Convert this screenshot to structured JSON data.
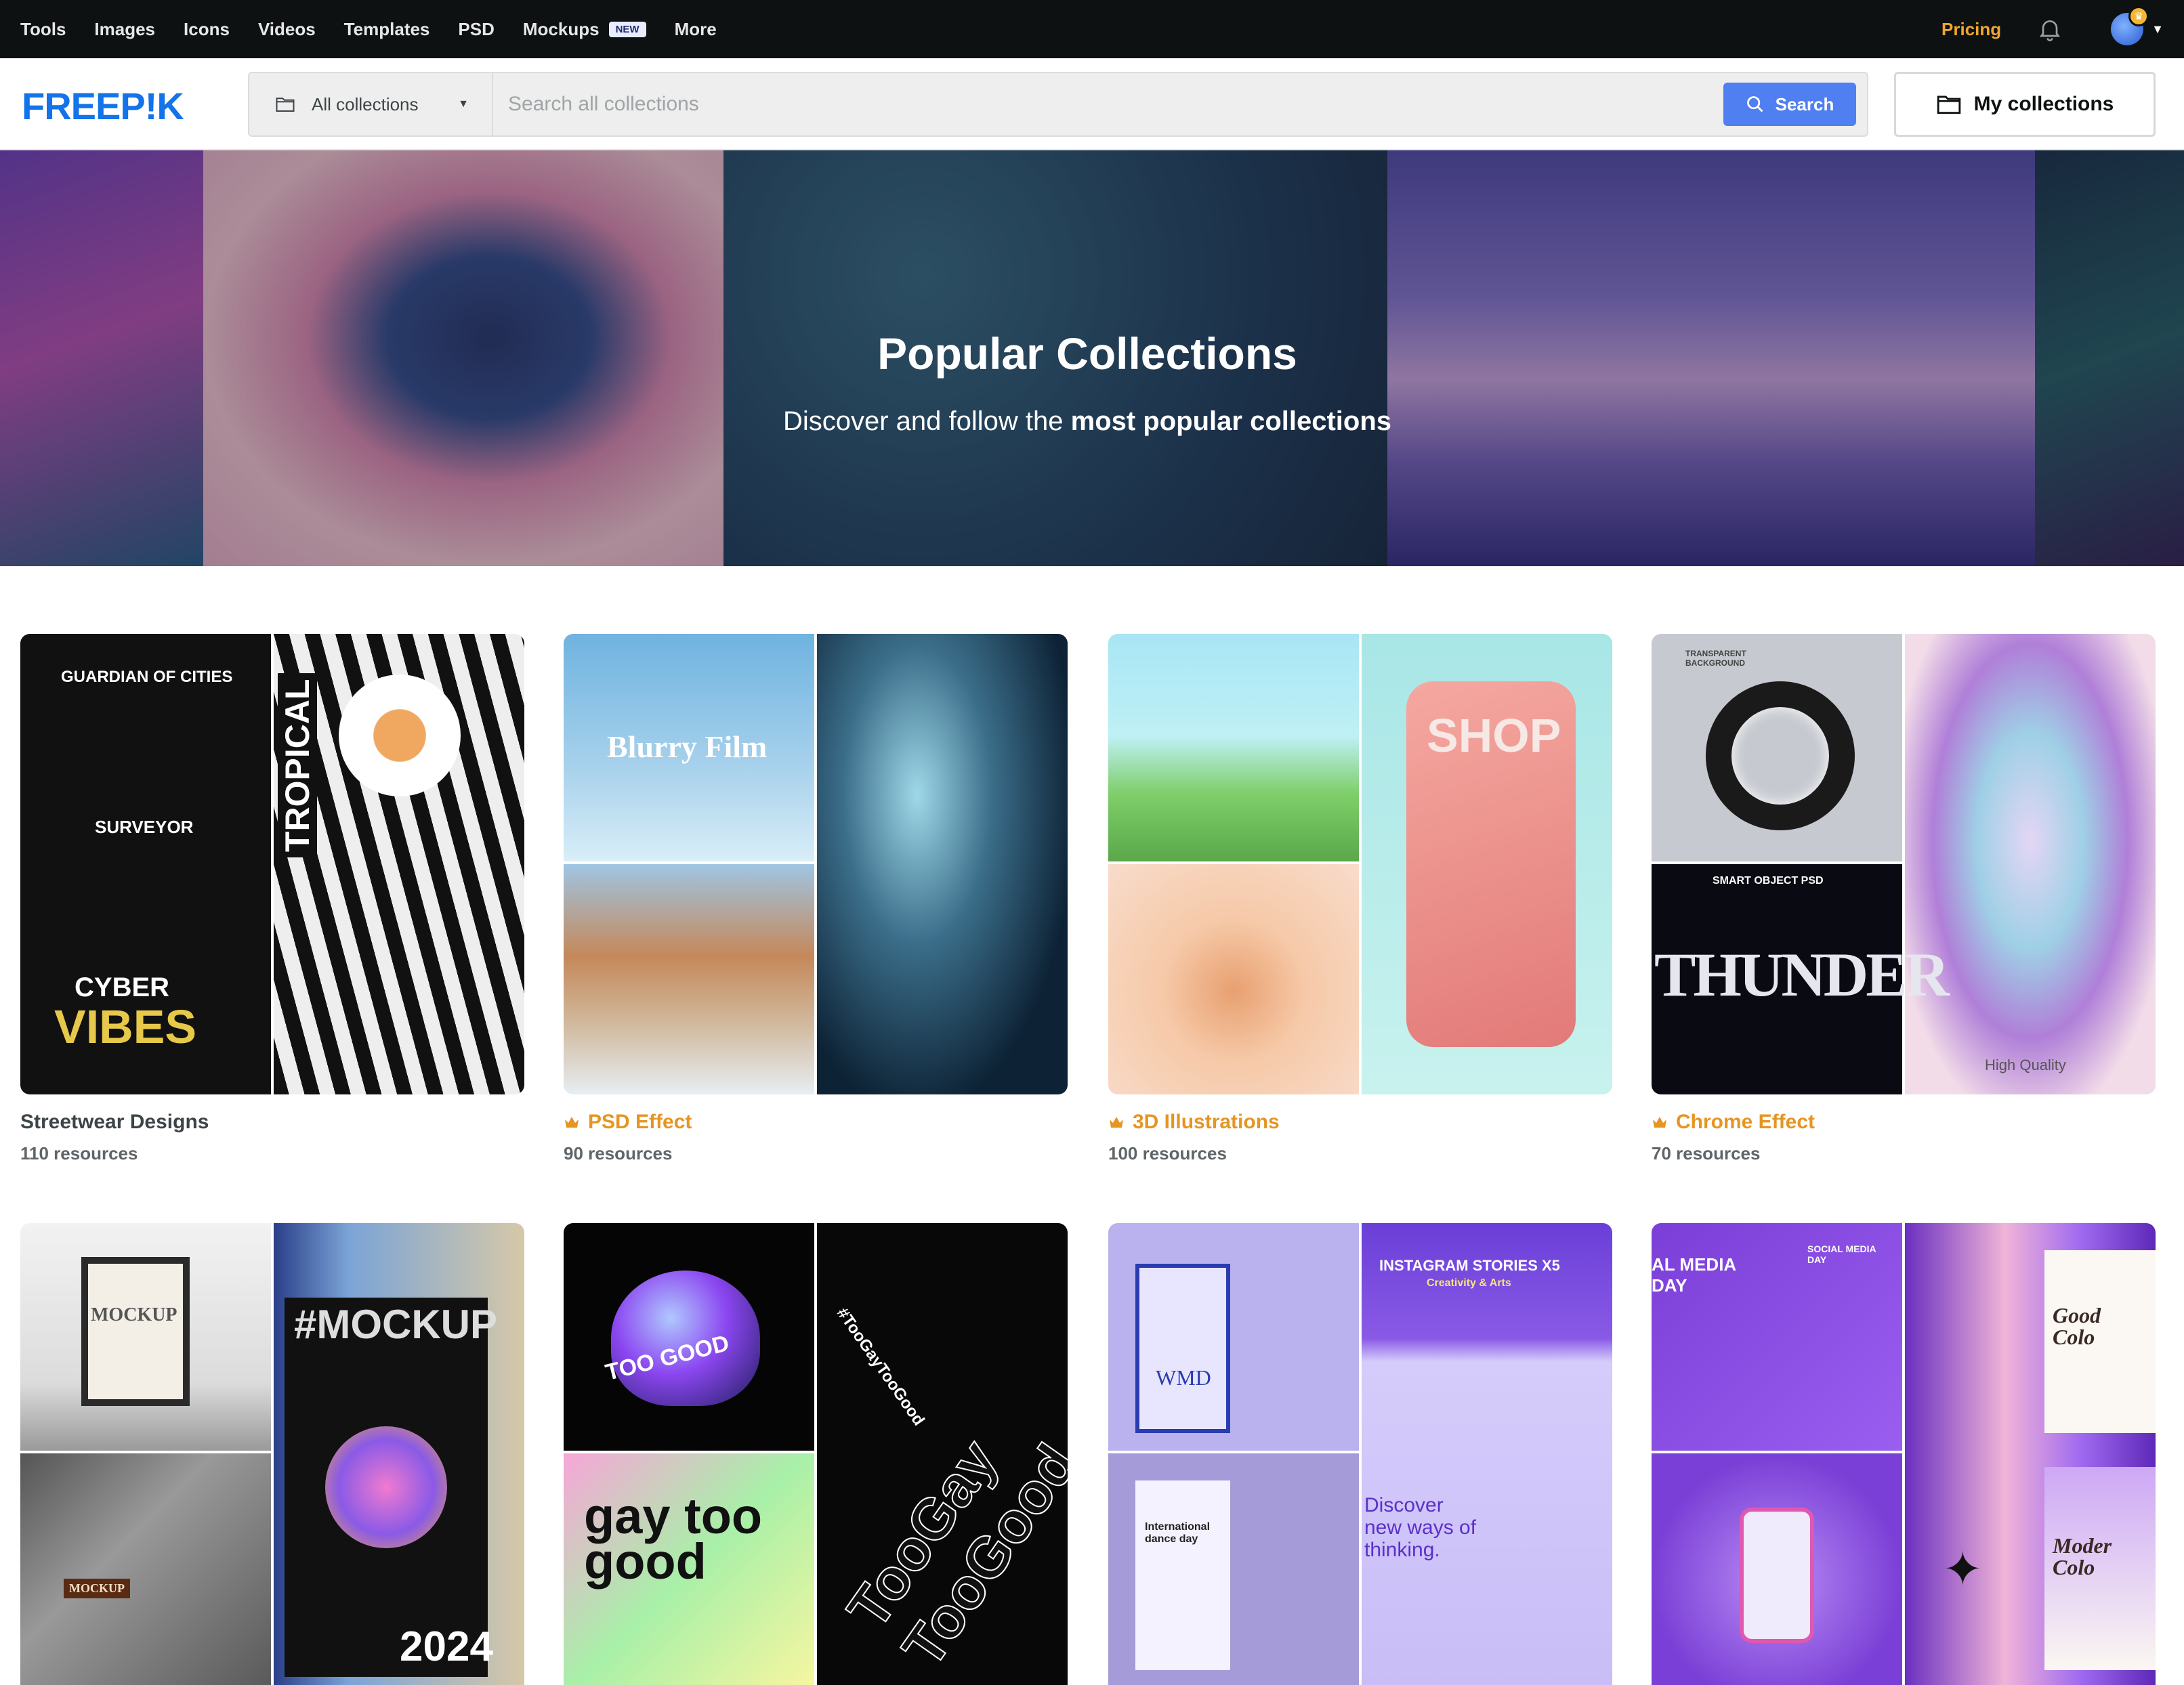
{
  "topnav": {
    "items": [
      "Tools",
      "Images",
      "Icons",
      "Videos",
      "Templates",
      "PSD",
      "Mockups",
      "More"
    ],
    "mockups_badge": "NEW",
    "pricing": "Pricing"
  },
  "header": {
    "logo": "FREEP!K",
    "collection_select": "All collections",
    "search_placeholder": "Search all collections",
    "search_button": "Search",
    "my_collections": "My collections"
  },
  "hero": {
    "title": "Popular Collections",
    "subtitle_start": "Discover and follow the ",
    "subtitle_bold": "most popular collections"
  },
  "collections": [
    {
      "title": "Streetwear Designs",
      "count": "110 resources",
      "premium": false,
      "thumb_text": {
        "a": "GUARDIAN OF CITIES",
        "b": "SURVEYOR",
        "c": "CYBER",
        "d": "VIBES",
        "e": "TROPICAL"
      }
    },
    {
      "title": "PSD Effect",
      "count": "90 resources",
      "premium": true,
      "thumb_text": {
        "a": "Blurry Film"
      }
    },
    {
      "title": "3D Illustrations",
      "count": "100 resources",
      "premium": true,
      "thumb_text": {
        "a": "SHOP"
      }
    },
    {
      "title": "Chrome Effect",
      "count": "70 resources",
      "premium": true,
      "thumb_text": {
        "a": "SMART OBJECT PSD",
        "b": "THUNDER",
        "c": "High Quality",
        "d": "TRANSPARENT BACKGROUND"
      }
    },
    {
      "title": "",
      "count": "",
      "premium": false,
      "thumb_text": {
        "a": "MOCKUP",
        "b": "#MOCKUP",
        "c": "2024",
        "d": "MOCKUP"
      }
    },
    {
      "title": "",
      "count": "",
      "premium": false,
      "thumb_text": {
        "a": "TOO GOOD",
        "b": "#TooGayTooGood",
        "c": "TooGay TooGood",
        "d": "gay too good"
      }
    },
    {
      "title": "",
      "count": "",
      "premium": false,
      "thumb_text": {
        "a": "WMD",
        "b": "INSTAGRAM STORIES X5",
        "c": "Creativity & Arts",
        "d": "Discover new ways of thinking.",
        "e": "International dance day"
      }
    },
    {
      "title": "",
      "count": "",
      "premium": false,
      "thumb_text": {
        "a": "AL MEDIA DAY",
        "b": "SOCIAL MEDIA DAY",
        "c": "Good Colo",
        "d": "Moder Colo"
      }
    }
  ]
}
